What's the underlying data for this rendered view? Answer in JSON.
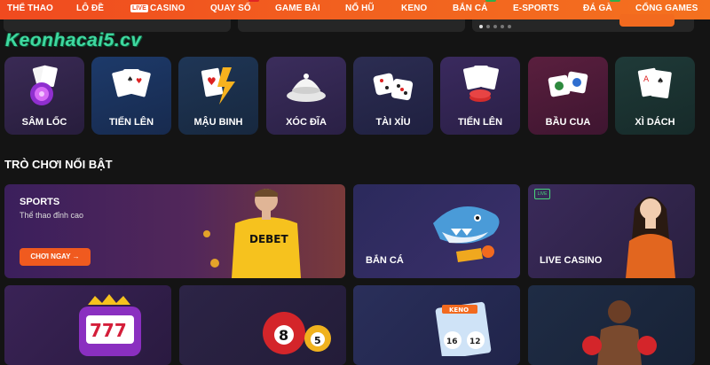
{
  "nav": {
    "items": [
      {
        "label": "THỂ THAO"
      },
      {
        "label": "LÔ ĐỀ"
      },
      {
        "label": "CASINO",
        "badge": "LIVE"
      },
      {
        "label": "QUAY SỐ"
      },
      {
        "label": "GAME BÀI"
      },
      {
        "label": "NỔ HŨ"
      },
      {
        "label": "KENO"
      },
      {
        "label": "BẮN CÁ"
      },
      {
        "label": "E-SPORTS"
      },
      {
        "label": "ĐÁ GÀ"
      },
      {
        "label": "CỔNG GAMES"
      }
    ]
  },
  "watermark": "Keonhacai5.cv",
  "categories": [
    {
      "label": "SÂM LỐC",
      "icon": "chips-cards-icon"
    },
    {
      "label": "TIẾN LÊN",
      "icon": "playing-cards-icon"
    },
    {
      "label": "MẬU BINH",
      "icon": "cards-lightning-icon"
    },
    {
      "label": "XÓC ĐĨA",
      "icon": "dish-coins-icon"
    },
    {
      "label": "TÀI XỈU",
      "icon": "dice-icon"
    },
    {
      "label": "TIẾN LÊN",
      "icon": "cards-chips-icon"
    },
    {
      "label": "BẦU CUA",
      "icon": "bau-cua-dice-icon"
    },
    {
      "label": "XÌ DÁCH",
      "icon": "blackjack-cards-icon"
    }
  ],
  "section": {
    "title": "TRÒ CHƠI NỔI BẬT"
  },
  "featured": {
    "sports": {
      "title": "SPORTS",
      "subtitle": "Thể thao đỉnh cao",
      "cta": "CHƠI NGAY",
      "jersey_text": "DEBET"
    },
    "fishing": {
      "title": "BẮN CÁ"
    },
    "live_casino": {
      "title": "LIVE CASINO",
      "tag": "LIVE"
    },
    "row2": [
      {
        "name": "slots",
        "icon": "slot-777-icon",
        "text": "777"
      },
      {
        "name": "lottery",
        "icon": "lottery-balls-icon",
        "ball1": "8",
        "ball2": "5"
      },
      {
        "name": "keno",
        "icon": "keno-card-icon",
        "label": "KENO",
        "num1": "16",
        "num2": "12"
      },
      {
        "name": "boxing",
        "icon": "boxer-icon"
      }
    ]
  },
  "colors": {
    "accent": "#f2611f",
    "background": "#141414"
  }
}
